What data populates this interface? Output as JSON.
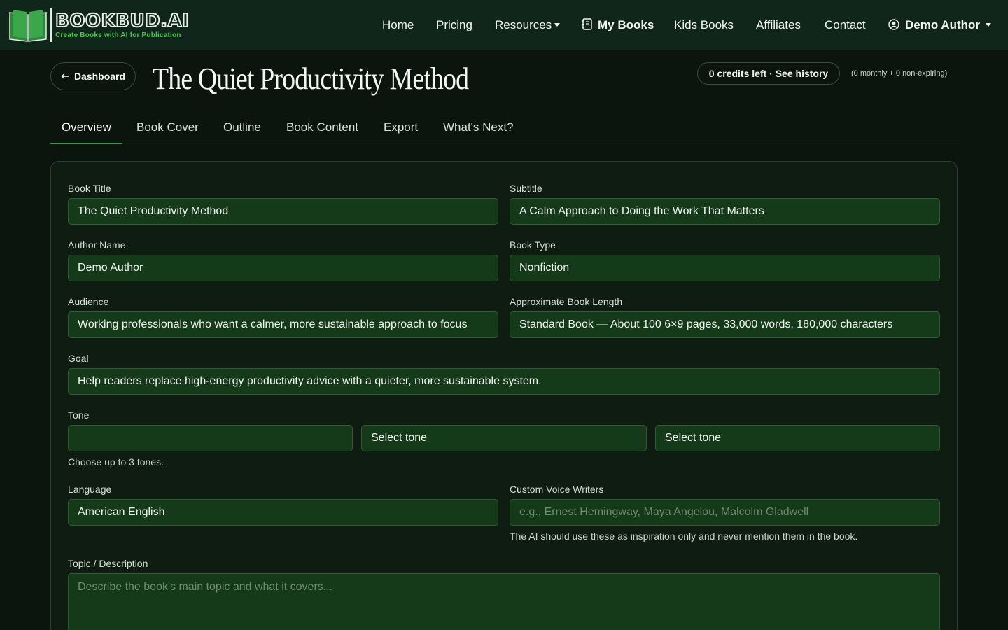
{
  "brand": {
    "name": "BOOKBUD.AI",
    "tagline": "Create Books with AI for Publication"
  },
  "nav": {
    "home": "Home",
    "pricing": "Pricing",
    "resources": "Resources",
    "my_books": "My Books",
    "kids_books": "Kids Books",
    "affiliates": "Affiliates",
    "contact": "Contact",
    "user": "Demo Author"
  },
  "header": {
    "back_label": "Dashboard",
    "title": "The Quiet Productivity Method",
    "credits": "0 credits left · See history",
    "credits_note": "(0 monthly + 0 non-expiring)"
  },
  "tabs": [
    "Overview",
    "Book Cover",
    "Outline",
    "Book Content",
    "Export",
    "What's Next?"
  ],
  "active_tab": "Overview",
  "form": {
    "book_title": {
      "label": "Book Title",
      "value": "The Quiet Productivity Method"
    },
    "subtitle": {
      "label": "Subtitle",
      "value": "A Calm Approach to Doing the Work That Matters"
    },
    "author_name": {
      "label": "Author Name",
      "value": "Demo Author"
    },
    "book_type": {
      "label": "Book Type",
      "value": "Nonfiction"
    },
    "audience": {
      "label": "Audience",
      "value": "Working professionals who want a calmer, more sustainable approach to focus"
    },
    "book_length": {
      "label": "Approximate Book Length",
      "value": "Standard Book — About 100 6×9 pages, 33,000 words, 180,000 characters"
    },
    "goal": {
      "label": "Goal",
      "value": "Help readers replace high-energy productivity advice with a quieter, more sustainable system."
    },
    "tone": {
      "label": "Tone",
      "selects": [
        "",
        "Select tone",
        "Select tone"
      ],
      "help": "Choose up to 3 tones."
    },
    "language": {
      "label": "Language",
      "value": "American English"
    },
    "custom_voice": {
      "label": "Custom Voice Writers",
      "placeholder": "e.g., Ernest Hemingway, Maya Angelou, Malcolm Gladwell",
      "help": "The AI should use these as inspiration only and never mention them in the book."
    },
    "topic": {
      "label": "Topic / Description",
      "placeholder": "Describe the book's main topic and what it covers..."
    }
  },
  "colors": {
    "background": "#0b150d",
    "navbar": "#10261a",
    "field": "#153a1a",
    "accent": "#2f9a4c",
    "brand_green": "#4cc24f"
  }
}
